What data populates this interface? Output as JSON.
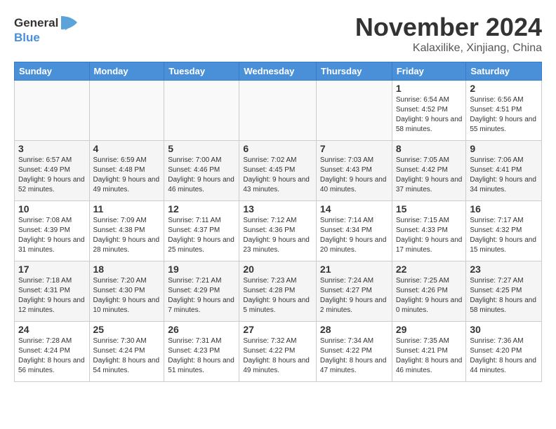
{
  "header": {
    "logo_line1": "General",
    "logo_line2": "Blue",
    "main_title": "November 2024",
    "subtitle": "Kalaxilike, Xinjiang, China"
  },
  "days_of_week": [
    "Sunday",
    "Monday",
    "Tuesday",
    "Wednesday",
    "Thursday",
    "Friday",
    "Saturday"
  ],
  "weeks": [
    [
      {
        "day": "",
        "empty": true
      },
      {
        "day": "",
        "empty": true
      },
      {
        "day": "",
        "empty": true
      },
      {
        "day": "",
        "empty": true
      },
      {
        "day": "",
        "empty": true
      },
      {
        "day": "1",
        "sunrise": "6:54 AM",
        "sunset": "4:52 PM",
        "daylight": "9 hours and 58 minutes."
      },
      {
        "day": "2",
        "sunrise": "6:56 AM",
        "sunset": "4:51 PM",
        "daylight": "9 hours and 55 minutes."
      }
    ],
    [
      {
        "day": "3",
        "sunrise": "6:57 AM",
        "sunset": "4:49 PM",
        "daylight": "9 hours and 52 minutes."
      },
      {
        "day": "4",
        "sunrise": "6:59 AM",
        "sunset": "4:48 PM",
        "daylight": "9 hours and 49 minutes."
      },
      {
        "day": "5",
        "sunrise": "7:00 AM",
        "sunset": "4:46 PM",
        "daylight": "9 hours and 46 minutes."
      },
      {
        "day": "6",
        "sunrise": "7:02 AM",
        "sunset": "4:45 PM",
        "daylight": "9 hours and 43 minutes."
      },
      {
        "day": "7",
        "sunrise": "7:03 AM",
        "sunset": "4:43 PM",
        "daylight": "9 hours and 40 minutes."
      },
      {
        "day": "8",
        "sunrise": "7:05 AM",
        "sunset": "4:42 PM",
        "daylight": "9 hours and 37 minutes."
      },
      {
        "day": "9",
        "sunrise": "7:06 AM",
        "sunset": "4:41 PM",
        "daylight": "9 hours and 34 minutes."
      }
    ],
    [
      {
        "day": "10",
        "sunrise": "7:08 AM",
        "sunset": "4:39 PM",
        "daylight": "9 hours and 31 minutes."
      },
      {
        "day": "11",
        "sunrise": "7:09 AM",
        "sunset": "4:38 PM",
        "daylight": "9 hours and 28 minutes."
      },
      {
        "day": "12",
        "sunrise": "7:11 AM",
        "sunset": "4:37 PM",
        "daylight": "9 hours and 25 minutes."
      },
      {
        "day": "13",
        "sunrise": "7:12 AM",
        "sunset": "4:36 PM",
        "daylight": "9 hours and 23 minutes."
      },
      {
        "day": "14",
        "sunrise": "7:14 AM",
        "sunset": "4:34 PM",
        "daylight": "9 hours and 20 minutes."
      },
      {
        "day": "15",
        "sunrise": "7:15 AM",
        "sunset": "4:33 PM",
        "daylight": "9 hours and 17 minutes."
      },
      {
        "day": "16",
        "sunrise": "7:17 AM",
        "sunset": "4:32 PM",
        "daylight": "9 hours and 15 minutes."
      }
    ],
    [
      {
        "day": "17",
        "sunrise": "7:18 AM",
        "sunset": "4:31 PM",
        "daylight": "9 hours and 12 minutes."
      },
      {
        "day": "18",
        "sunrise": "7:20 AM",
        "sunset": "4:30 PM",
        "daylight": "9 hours and 10 minutes."
      },
      {
        "day": "19",
        "sunrise": "7:21 AM",
        "sunset": "4:29 PM",
        "daylight": "9 hours and 7 minutes."
      },
      {
        "day": "20",
        "sunrise": "7:23 AM",
        "sunset": "4:28 PM",
        "daylight": "9 hours and 5 minutes."
      },
      {
        "day": "21",
        "sunrise": "7:24 AM",
        "sunset": "4:27 PM",
        "daylight": "9 hours and 2 minutes."
      },
      {
        "day": "22",
        "sunrise": "7:25 AM",
        "sunset": "4:26 PM",
        "daylight": "9 hours and 0 minutes."
      },
      {
        "day": "23",
        "sunrise": "7:27 AM",
        "sunset": "4:25 PM",
        "daylight": "8 hours and 58 minutes."
      }
    ],
    [
      {
        "day": "24",
        "sunrise": "7:28 AM",
        "sunset": "4:24 PM",
        "daylight": "8 hours and 56 minutes."
      },
      {
        "day": "25",
        "sunrise": "7:30 AM",
        "sunset": "4:24 PM",
        "daylight": "8 hours and 54 minutes."
      },
      {
        "day": "26",
        "sunrise": "7:31 AM",
        "sunset": "4:23 PM",
        "daylight": "8 hours and 51 minutes."
      },
      {
        "day": "27",
        "sunrise": "7:32 AM",
        "sunset": "4:22 PM",
        "daylight": "8 hours and 49 minutes."
      },
      {
        "day": "28",
        "sunrise": "7:34 AM",
        "sunset": "4:22 PM",
        "daylight": "8 hours and 47 minutes."
      },
      {
        "day": "29",
        "sunrise": "7:35 AM",
        "sunset": "4:21 PM",
        "daylight": "8 hours and 46 minutes."
      },
      {
        "day": "30",
        "sunrise": "7:36 AM",
        "sunset": "4:20 PM",
        "daylight": "8 hours and 44 minutes."
      }
    ]
  ]
}
